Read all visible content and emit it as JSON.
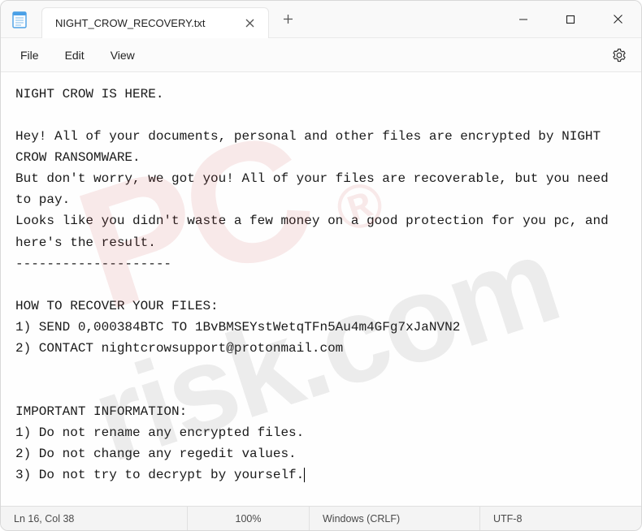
{
  "titlebar": {
    "tab_title": "NIGHT_CROW_RECOVERY.txt"
  },
  "menu": {
    "file": "File",
    "edit": "Edit",
    "view": "View"
  },
  "document": {
    "text": "NIGHT CROW IS HERE.\n\nHey! All of your documents, personal and other files are encrypted by NIGHT CROW RANSOMWARE.\nBut don't worry, we got you! All of your files are recoverable, but you need to pay.\nLooks like you didn't waste a few money on a good protection for you pc, and here's the result.\n--------------------\n\nHOW TO RECOVER YOUR FILES:\n1) SEND 0,000384BTC TO 1BvBMSEYstWetqTFn5Au4m4GFg7xJaNVN2\n2) CONTACT nightcrowsupport@protonmail.com\n\n\nIMPORTANT INFORMATION:\n1) Do not rename any encrypted files.\n2) Do not change any regedit values.\n3) Do not try to decrypt by yourself."
  },
  "statusbar": {
    "position": "Ln 16, Col 38",
    "zoom": "100%",
    "eol": "Windows (CRLF)",
    "encoding": "UTF-8"
  }
}
